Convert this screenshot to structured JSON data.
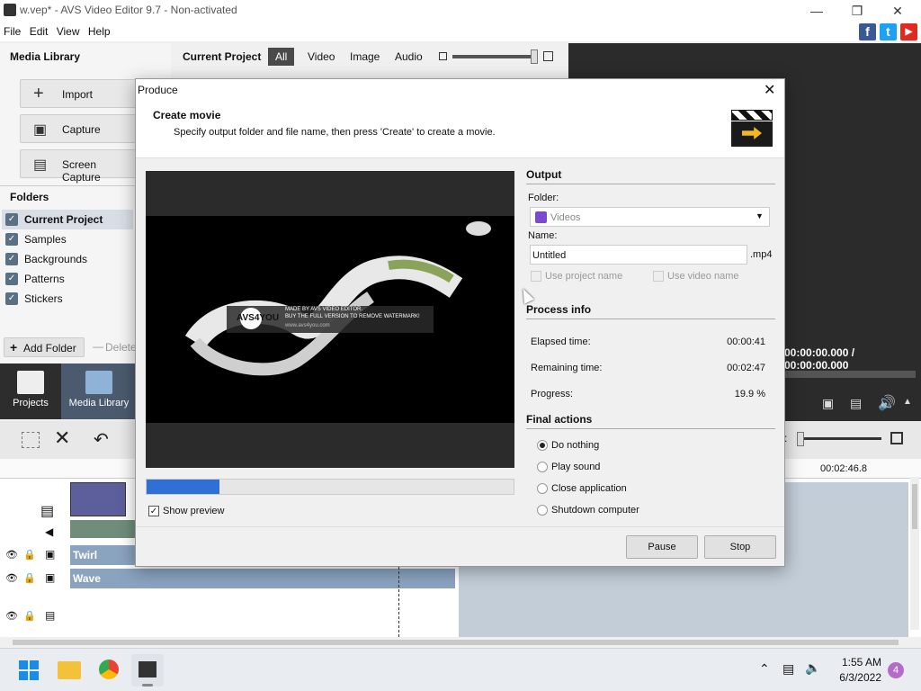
{
  "window": {
    "title": "w.vep* - AVS Video Editor 9.7 - Non-activated",
    "menu": [
      "File",
      "Edit",
      "View",
      "Help"
    ],
    "social_icons": [
      "facebook-icon",
      "twitter-icon",
      "youtube-icon"
    ]
  },
  "left_panel": {
    "title": "Media Library",
    "buttons": [
      {
        "label": "Import",
        "icon": "plus-icon"
      },
      {
        "label": "Capture",
        "icon": "camera-icon"
      },
      {
        "label": "Screen Capture",
        "icon": "screen-icon"
      }
    ],
    "folders_title": "Folders",
    "folders": [
      "Current Project",
      "Samples",
      "Backgrounds",
      "Patterns",
      "Stickers"
    ],
    "add_folder": "Add Folder",
    "delete": "Delete"
  },
  "project_bar": {
    "title": "Current Project",
    "tabs": [
      "All",
      "Video",
      "Image",
      "Audio"
    ]
  },
  "nav": {
    "items": [
      "Projects",
      "Media Library"
    ]
  },
  "player": {
    "time": "00:00:00.000 / 00:00:00.000",
    "timeline_time": "00:02:46.8"
  },
  "tracks": [
    "Twirl",
    "Wave"
  ],
  "dialog": {
    "title": "Produce",
    "header_title": "Create movie",
    "header_desc": "Specify output folder and file name, then press 'Create' to create a movie.",
    "watermark_line1": "MADE BY AVS VIDEO EDITOR.",
    "watermark_line2": "BUY THE FULL VERSION TO REMOVE WATERMARK!",
    "watermark_line3": "www.avs4you.com",
    "watermark_logo": "AVS4YOU",
    "progress_fraction": 0.199,
    "show_preview": "Show preview",
    "output": {
      "title": "Output",
      "folder_label": "Folder:",
      "folder_value": "Videos",
      "name_label": "Name:",
      "name_value": "Untitled",
      "ext": ".mp4",
      "use_project_name": "Use project name",
      "use_video_name": "Use video name"
    },
    "process": {
      "title": "Process info",
      "elapsed_label": "Elapsed time:",
      "elapsed_value": "00:00:41",
      "remaining_label": "Remaining time:",
      "remaining_value": "00:02:47",
      "progress_label": "Progress:",
      "progress_value": "19.9 %"
    },
    "final": {
      "title": "Final actions",
      "options": [
        "Do nothing",
        "Play sound",
        "Close application",
        "Shutdown computer"
      ],
      "selected": 0
    },
    "pause": "Pause",
    "stop": "Stop"
  },
  "taskbar": {
    "time": "1:55 AM",
    "date": "6/3/2022",
    "notification_count": "4"
  },
  "colors": {
    "accent": "#2f6fd6",
    "dark": "#2b2b2b",
    "track": "#8aa3bf"
  }
}
